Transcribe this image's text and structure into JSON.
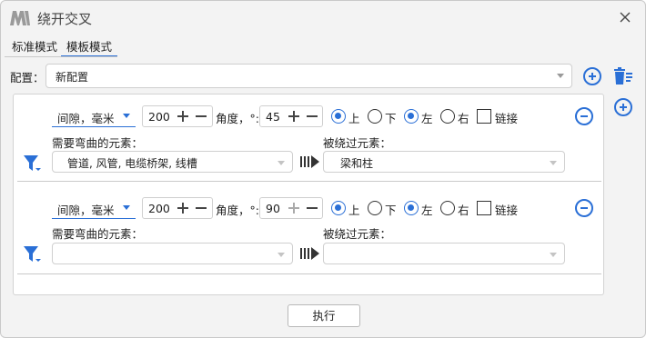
{
  "window": {
    "title": "绕开交叉"
  },
  "tabs": [
    {
      "label": "标准模式",
      "active": false
    },
    {
      "label": "模板模式",
      "active": true
    }
  ],
  "config": {
    "label": "配置：",
    "selected": "新配置"
  },
  "rules": [
    {
      "unit": "间隙，毫米",
      "gap": "200",
      "angle_label": "角度，°:",
      "angle": "45",
      "options": {
        "up": "上",
        "down": "下",
        "left": "左",
        "right": "右",
        "link": "链接"
      },
      "selected": {
        "vertical": "上",
        "horizontal": "左",
        "link": false
      },
      "bend_label": "需要弯曲的元素：",
      "bend_value": "管道, 风管, 电缆桥架, 线槽",
      "bypass_label": "被绕过元素：",
      "bypass_value": "梁和柱"
    },
    {
      "unit": "间隙，毫米",
      "gap": "200",
      "angle_label": "角度，°:",
      "angle": "90",
      "options": {
        "up": "上",
        "down": "下",
        "left": "左",
        "right": "右",
        "link": "链接"
      },
      "selected": {
        "vertical": "上",
        "horizontal": "左",
        "link": false
      },
      "bend_label": "需要弯曲的元素：",
      "bend_value": "",
      "bypass_label": "被绕过元素：",
      "bypass_value": ""
    }
  ],
  "execute_label": "执行",
  "colors": {
    "accent": "#2a6fd6",
    "window_bg": "#f3f3f3"
  }
}
